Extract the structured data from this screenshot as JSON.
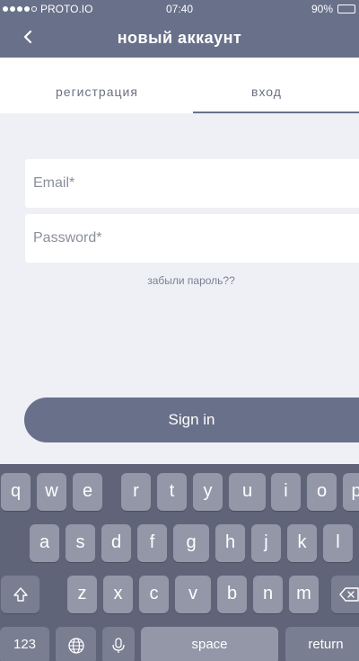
{
  "status_bar": {
    "carrier": "PROTO.IO",
    "time": "07:40",
    "battery": "90%"
  },
  "nav": {
    "title": "новый аккаунт",
    "back_icon": "chevron-left-icon"
  },
  "tabs": [
    {
      "label": "регистрация",
      "active": false
    },
    {
      "label": "вход",
      "active": true
    }
  ],
  "form": {
    "email_placeholder": "Email*",
    "email_value": "",
    "password_placeholder": "Password*",
    "password_value": "",
    "forgot_label": "забыли пароль??",
    "signin_label": "Sign in"
  },
  "keyboard": {
    "row1": [
      "q",
      "w",
      "e",
      "r",
      "t",
      "y",
      "u",
      "i",
      "o",
      "p"
    ],
    "row2": [
      "a",
      "s",
      "d",
      "f",
      "g",
      "h",
      "j",
      "k",
      "l"
    ],
    "row3": [
      "z",
      "x",
      "c",
      "v",
      "b",
      "n",
      "m"
    ],
    "numbers_label": "123",
    "space_label": "space",
    "return_label": "return",
    "icons": {
      "shift": "shift-icon",
      "delete": "backspace-icon",
      "globe": "globe-icon",
      "mic": "microphone-icon"
    }
  },
  "colors": {
    "header": "#69708a",
    "background": "#eef0f6",
    "keyboard": "#5f6478",
    "key": "#9397a8"
  }
}
